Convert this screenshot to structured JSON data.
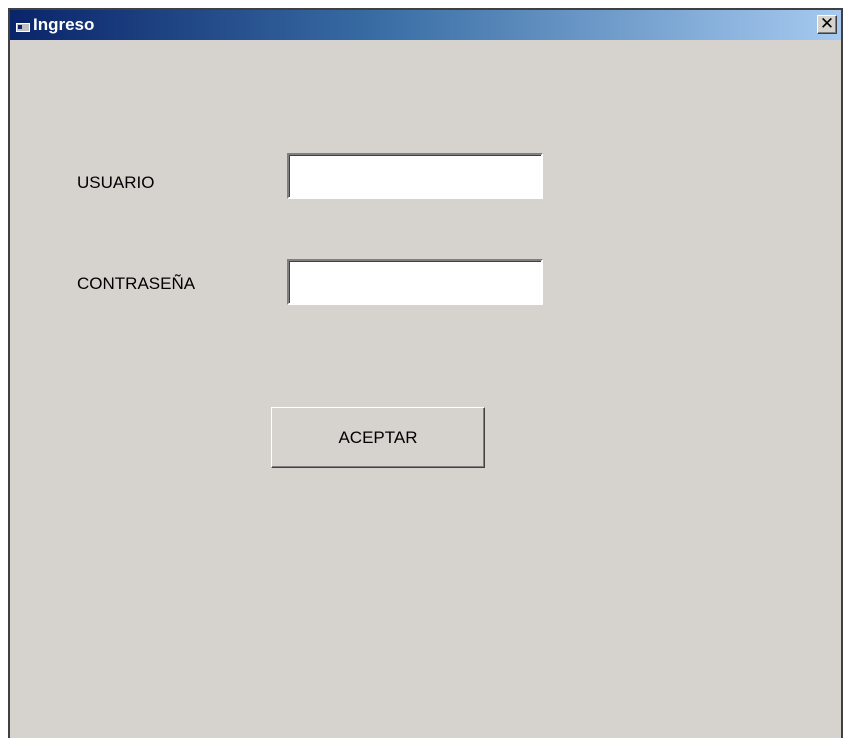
{
  "window": {
    "title": "Ingreso",
    "icon": "app-window-icon",
    "close_label": "✕"
  },
  "form": {
    "usuario_label": "USUARIO",
    "usuario_value": "",
    "contrasena_label": "CONTRASEÑA",
    "contrasena_value": "",
    "accept_label": "ACEPTAR"
  },
  "colors": {
    "titlebar_start": "#0a246a",
    "titlebar_end": "#a6caf0",
    "window_bg": "#d6d3ce"
  }
}
